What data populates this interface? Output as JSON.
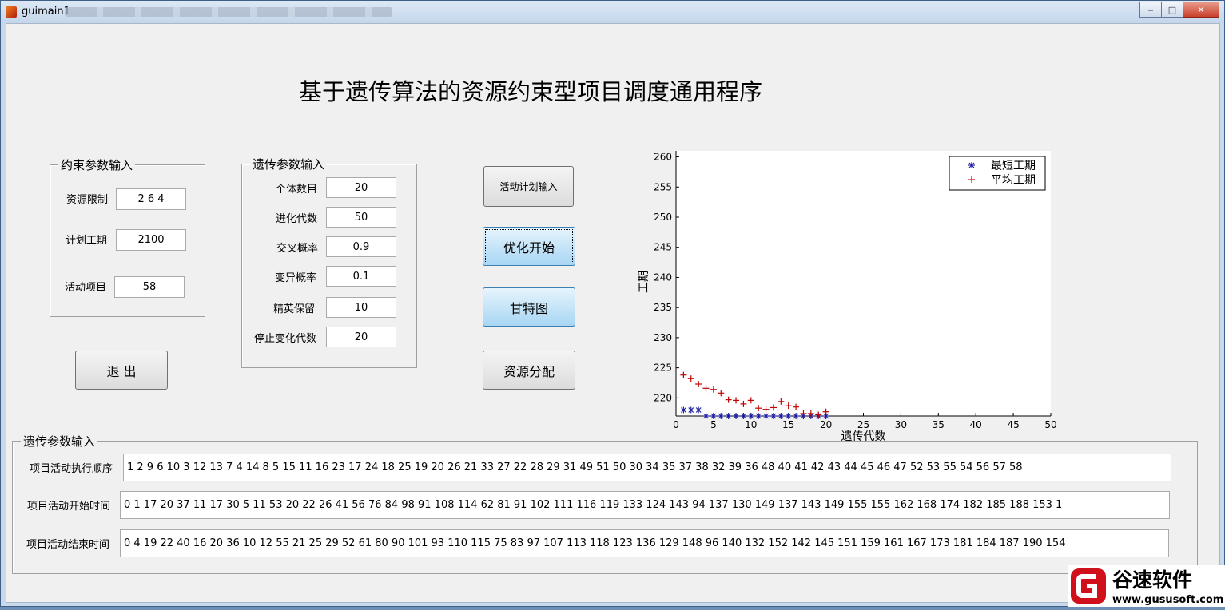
{
  "window": {
    "title": "guimain1",
    "minimize_icon": "minimize-icon",
    "maximize_icon": "maximize-icon",
    "close_icon": "close-icon"
  },
  "main_title": "基于遗传算法的资源约束型项目调度通用程序",
  "constraint_panel": {
    "title": "约束参数输入",
    "fields": [
      {
        "label": "资源限制",
        "value": "2  6  4"
      },
      {
        "label": "计划工期",
        "value": "2100"
      },
      {
        "label": "活动项目",
        "value": "58"
      }
    ]
  },
  "genetic_panel": {
    "title": "遗传参数输入",
    "fields": [
      {
        "label": "个体数目",
        "value": "20"
      },
      {
        "label": "进化代数",
        "value": "50"
      },
      {
        "label": "交叉概率",
        "value": "0.9"
      },
      {
        "label": "变异概率",
        "value": "0.1"
      },
      {
        "label": "精英保留",
        "value": "10"
      },
      {
        "label": "停止变化代数",
        "value": "20"
      }
    ]
  },
  "buttons": {
    "exit": "退  出",
    "activity_plan_input": "活动计划输入",
    "optimize_start": "优化开始",
    "gantt": "甘特图",
    "resource_allocation": "资源分配"
  },
  "results_panel": {
    "title": "遗传参数输入",
    "rows": [
      {
        "label": "项目活动执行顺序",
        "value": "1   2   9   6   10   3   12   13   7   4   14   8   5   15   11   16   23   17   24   18   25   19   20   26   21   33   27   22   28   29   31   49   51   50   30   34   35   37   38   32   39   36   48   40   41   42   43   44   45   46   47   52   53   55   54   56   57   58"
      },
      {
        "label": "项目活动开始时间",
        "value": "0    1   17   20   37   11   17   30    5   11   53   20   22   26   41   56   76   84   98   91  108  114   62   81   91  102  111  116  119  133  124  143   94  137  130  149  137  143  149  155  155  162  168  174  182  185  188  153  1"
      },
      {
        "label": "项目活动结束时间",
        "value": "0    4   19   22   40   16   20   36   10   12   55   21   25   29   52   61   80   90  101   93  110  115   75   83   97  107  113  118  123  136  129  148   96  140  132  152  142  145  151  159  161  167  173  181  184  187  190  154"
      }
    ]
  },
  "chart_data": {
    "type": "scatter",
    "xlabel": "遗传代数",
    "ylabel": "工期",
    "xlim": [
      0,
      50
    ],
    "ylim": [
      217,
      261
    ],
    "xticks": [
      0,
      5,
      10,
      15,
      20,
      25,
      30,
      35,
      40,
      45,
      50
    ],
    "yticks": [
      220,
      225,
      230,
      235,
      240,
      245,
      250,
      255,
      260
    ],
    "legend_position": "top-right",
    "series": [
      {
        "name": "最短工期",
        "marker": "*",
        "color": "#1a1aa0",
        "x": [
          1,
          2,
          3,
          4,
          5,
          6,
          7,
          8,
          9,
          10,
          11,
          12,
          13,
          14,
          15,
          16,
          17,
          18,
          19,
          20
        ],
        "y": [
          218,
          218,
          218,
          217,
          217,
          217,
          217,
          217,
          217,
          217,
          217,
          217,
          217,
          217,
          217,
          217,
          217,
          217,
          217,
          217
        ]
      },
      {
        "name": "平均工期",
        "marker": "+",
        "color": "#c00000",
        "x": [
          1,
          2,
          3,
          4,
          5,
          6,
          7,
          8,
          9,
          10,
          11,
          12,
          13,
          14,
          15,
          16,
          17,
          18,
          19,
          20
        ],
        "y": [
          223.8,
          223.2,
          222.3,
          221.6,
          221.4,
          220.8,
          219.7,
          219.6,
          219.0,
          219.6,
          218.3,
          218.1,
          218.4,
          219.4,
          218.7,
          218.5,
          217.4,
          217.4,
          217.2,
          217.7
        ]
      }
    ]
  },
  "watermark": {
    "brand": "谷速软件",
    "url": "www.gususoft.com"
  }
}
